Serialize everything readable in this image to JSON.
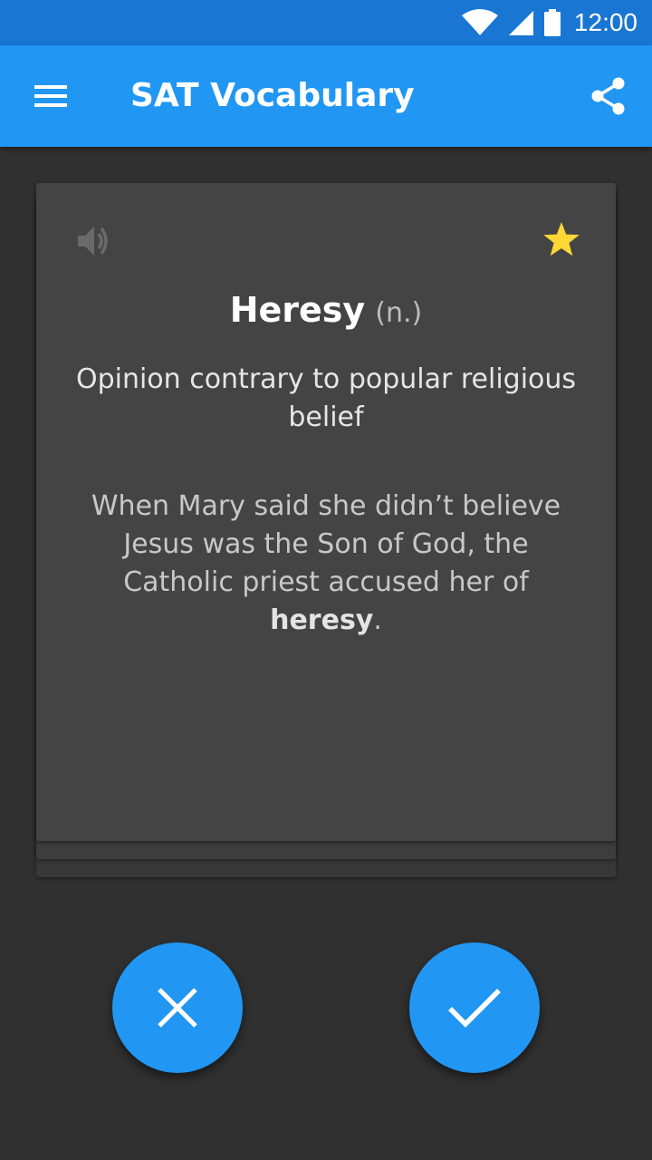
{
  "status_bar": {
    "time": "12:00",
    "icons": [
      "wifi-icon",
      "signal-icon",
      "battery-icon"
    ]
  },
  "app_bar": {
    "title": "SAT Vocabulary",
    "menu_icon": "menu-icon",
    "share_icon": "share-icon",
    "color": "#2196f3"
  },
  "card": {
    "audio_icon": "speaker-icon",
    "favorite_icon": "star-icon",
    "favorite_color": "#fdd835",
    "word": "Heresy",
    "part_of_speech": "(n.)",
    "definition": "Opinion contrary to popular religious belief",
    "example": {
      "before": "When Mary said she didn’t believe Jesus was the Son of God, the Catholic priest accused her of ",
      "highlight": "heresy",
      "after": "."
    }
  },
  "actions": {
    "reject_icon": "close-icon",
    "accept_icon": "check-icon",
    "button_color": "#2196f3"
  }
}
